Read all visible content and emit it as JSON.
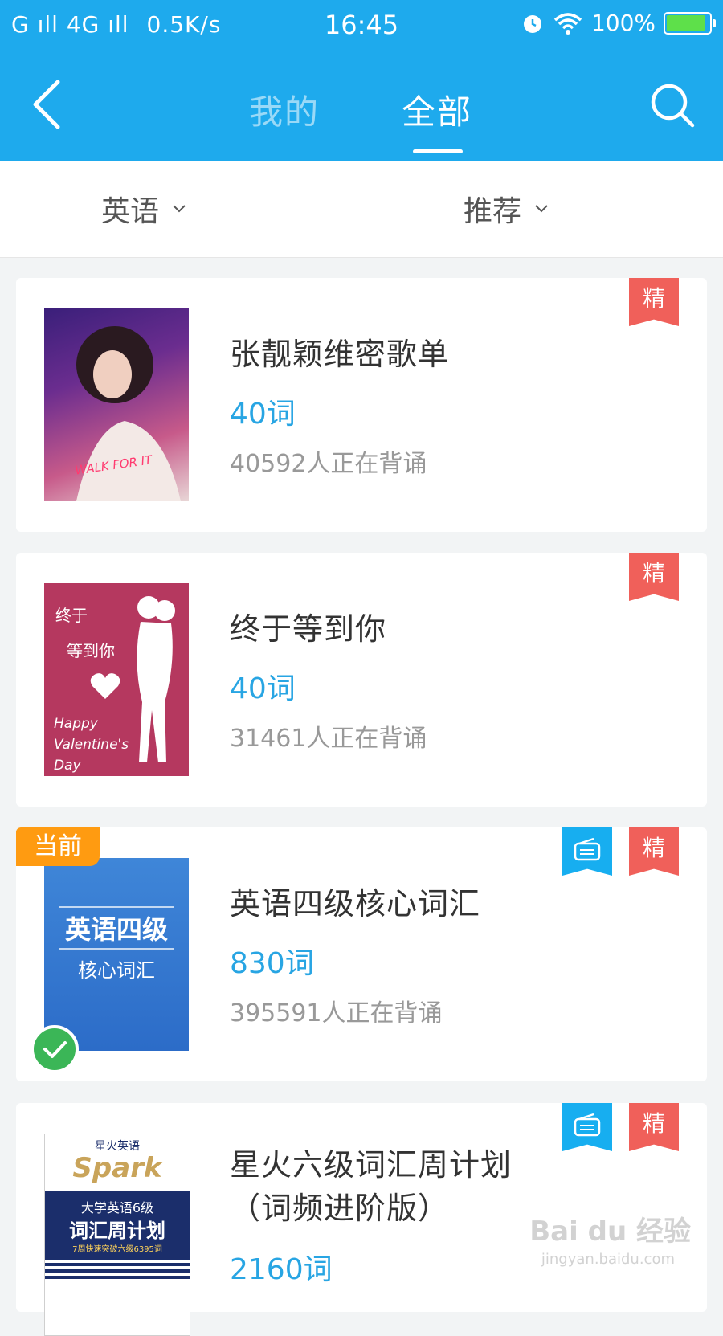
{
  "status_bar": {
    "signal_text": "G ıll 4G ıll",
    "speed": "0.5K/s",
    "time": "16:45",
    "battery": "100%"
  },
  "nav": {
    "tabs": [
      {
        "label": "我的",
        "active": false
      },
      {
        "label": "全部",
        "active": true
      }
    ],
    "accent_color": "#1eaaed"
  },
  "filters": {
    "language": "英语",
    "sort": "推荐"
  },
  "wordbooks": [
    {
      "title": "张靓颖维密歌单",
      "word_count": "40词",
      "learners": "40592人正在背诵",
      "badge": "精",
      "cover_text": "WALK FOR IT"
    },
    {
      "title": "终于等到你",
      "word_count": "40词",
      "learners": "31461人正在背诵",
      "badge": "精",
      "cover_text_top": "终于",
      "cover_text_mid": "等到你",
      "cover_text_bottom": "Happy Valentine's Day"
    },
    {
      "title": "英语四级核心词汇",
      "word_count": "830词",
      "learners": "395591人正在背诵",
      "badge": "精",
      "current_tag": "当前",
      "cover_text_main": "英语四级",
      "cover_text_sub": "核心词汇"
    },
    {
      "title": "星火六级词汇周计划（词频进阶版）",
      "word_count": "2160词",
      "badge": "精",
      "cover_brand": "Spark",
      "cover_brand_cn": "星火英语",
      "cover_line1": "大学英语6级",
      "cover_line2": "词汇周计划",
      "cover_line3": "7周快速突破六级6395词"
    }
  ],
  "watermark": {
    "main": "Bai du 经验",
    "sub": "jingyan.baidu.com"
  }
}
